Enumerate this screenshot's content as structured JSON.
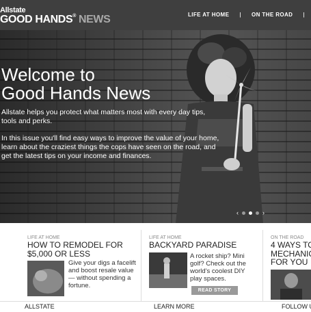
{
  "header": {
    "brand_small": "Allstate",
    "brand_main": "GOOD HANDS",
    "brand_mark": "®",
    "brand_suffix": "NEWS",
    "nav": [
      "LIFE AT HOME",
      "ON THE ROAD"
    ]
  },
  "hero": {
    "title_line1": "Welcome to",
    "title_line2": "Good Hands News",
    "intro": "Allstate helps you protect what matters most with every day tips, tools and perks.",
    "body": "In this issue you'll find easy ways to improve the value of your home, learn about the craziest things the cops have seen on the road, and get the latest tips on your income and finances.",
    "prev_arrow": "‹",
    "next_arrow": "›",
    "slide_count": 3,
    "active_slide": 2
  },
  "cards": [
    {
      "category": "LIFE AT HOME",
      "title_line1": "HOW TO REMODEL FOR",
      "title_line2": "$5,000 OR LESS",
      "description": "Give your digs a facelift and boost resale value — without spending a fortune."
    },
    {
      "category": "LIFE AT HOME",
      "title_line1": "BACKYARD PARADISE",
      "description": "A rocket ship? Mini golf? Check out the world's coolest DIY play spaces.",
      "button": "READ STORY"
    },
    {
      "category": "ON THE ROAD",
      "title_line1": "4 WAYS TO",
      "title_line2": "MECHANIC",
      "title_line3": "FOR YOU"
    }
  ],
  "footer": {
    "left": "ALLSTATE",
    "center": "LEARN MORE",
    "right": "FOLLOW U"
  }
}
